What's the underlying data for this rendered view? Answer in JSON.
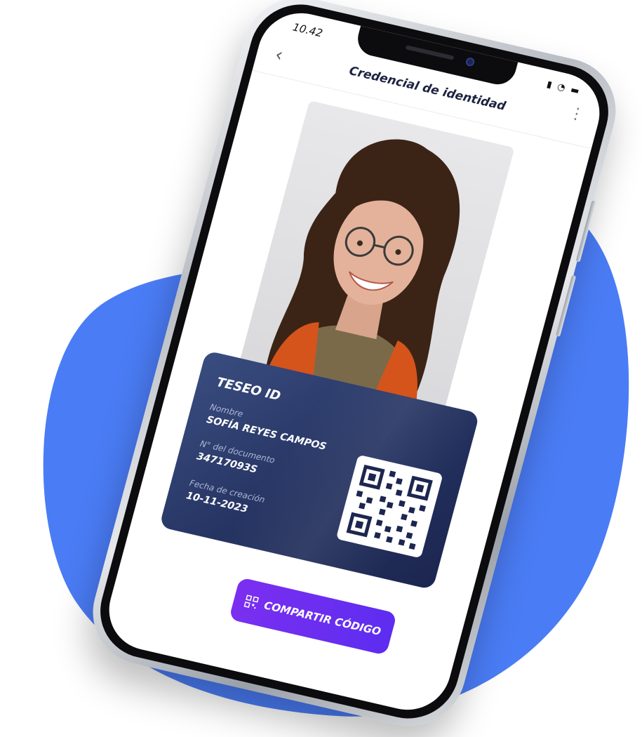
{
  "status_bar": {
    "time": "10.42",
    "icons": [
      "signal-icon",
      "wifi-icon",
      "battery-icon"
    ]
  },
  "header": {
    "title": "Credencial de identidad",
    "back_icon": "chevron-left-icon",
    "more_icon": "more-vertical-icon"
  },
  "card": {
    "brand": "TESEO ID",
    "fields": [
      {
        "label": "Nombre",
        "value": "SOFÍA REYES CAMPOS"
      },
      {
        "label": "N° del documento",
        "value": "34717093S"
      },
      {
        "label": "Fecha de creación",
        "value": "10-11-2023"
      }
    ]
  },
  "share_button": {
    "label": "COMPARTIR CÓDIGO",
    "icon": "qr-code-icon"
  },
  "colors": {
    "background_blob": "#4a7cf5",
    "card_bg": "#2a3a6b",
    "share_button": "#6c2ef2",
    "title_text": "#1c2240"
  }
}
